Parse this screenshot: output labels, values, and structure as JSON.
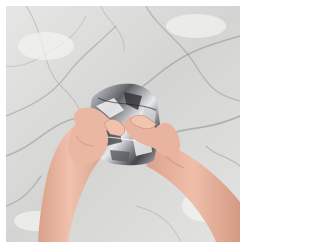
{
  "image": {
    "subject": "hands-crumpling-foil-icon",
    "colors": {
      "marble_base": "#d8d8d7",
      "marble_light": "#eeeeec",
      "marble_vein": "#8a8a88",
      "skin": "#e9b6a1",
      "skin_shadow": "#c98b74",
      "foil_dark": "#2f2f31",
      "foil_mid": "#8e9197",
      "foil_light": "#f2f2f0"
    }
  }
}
